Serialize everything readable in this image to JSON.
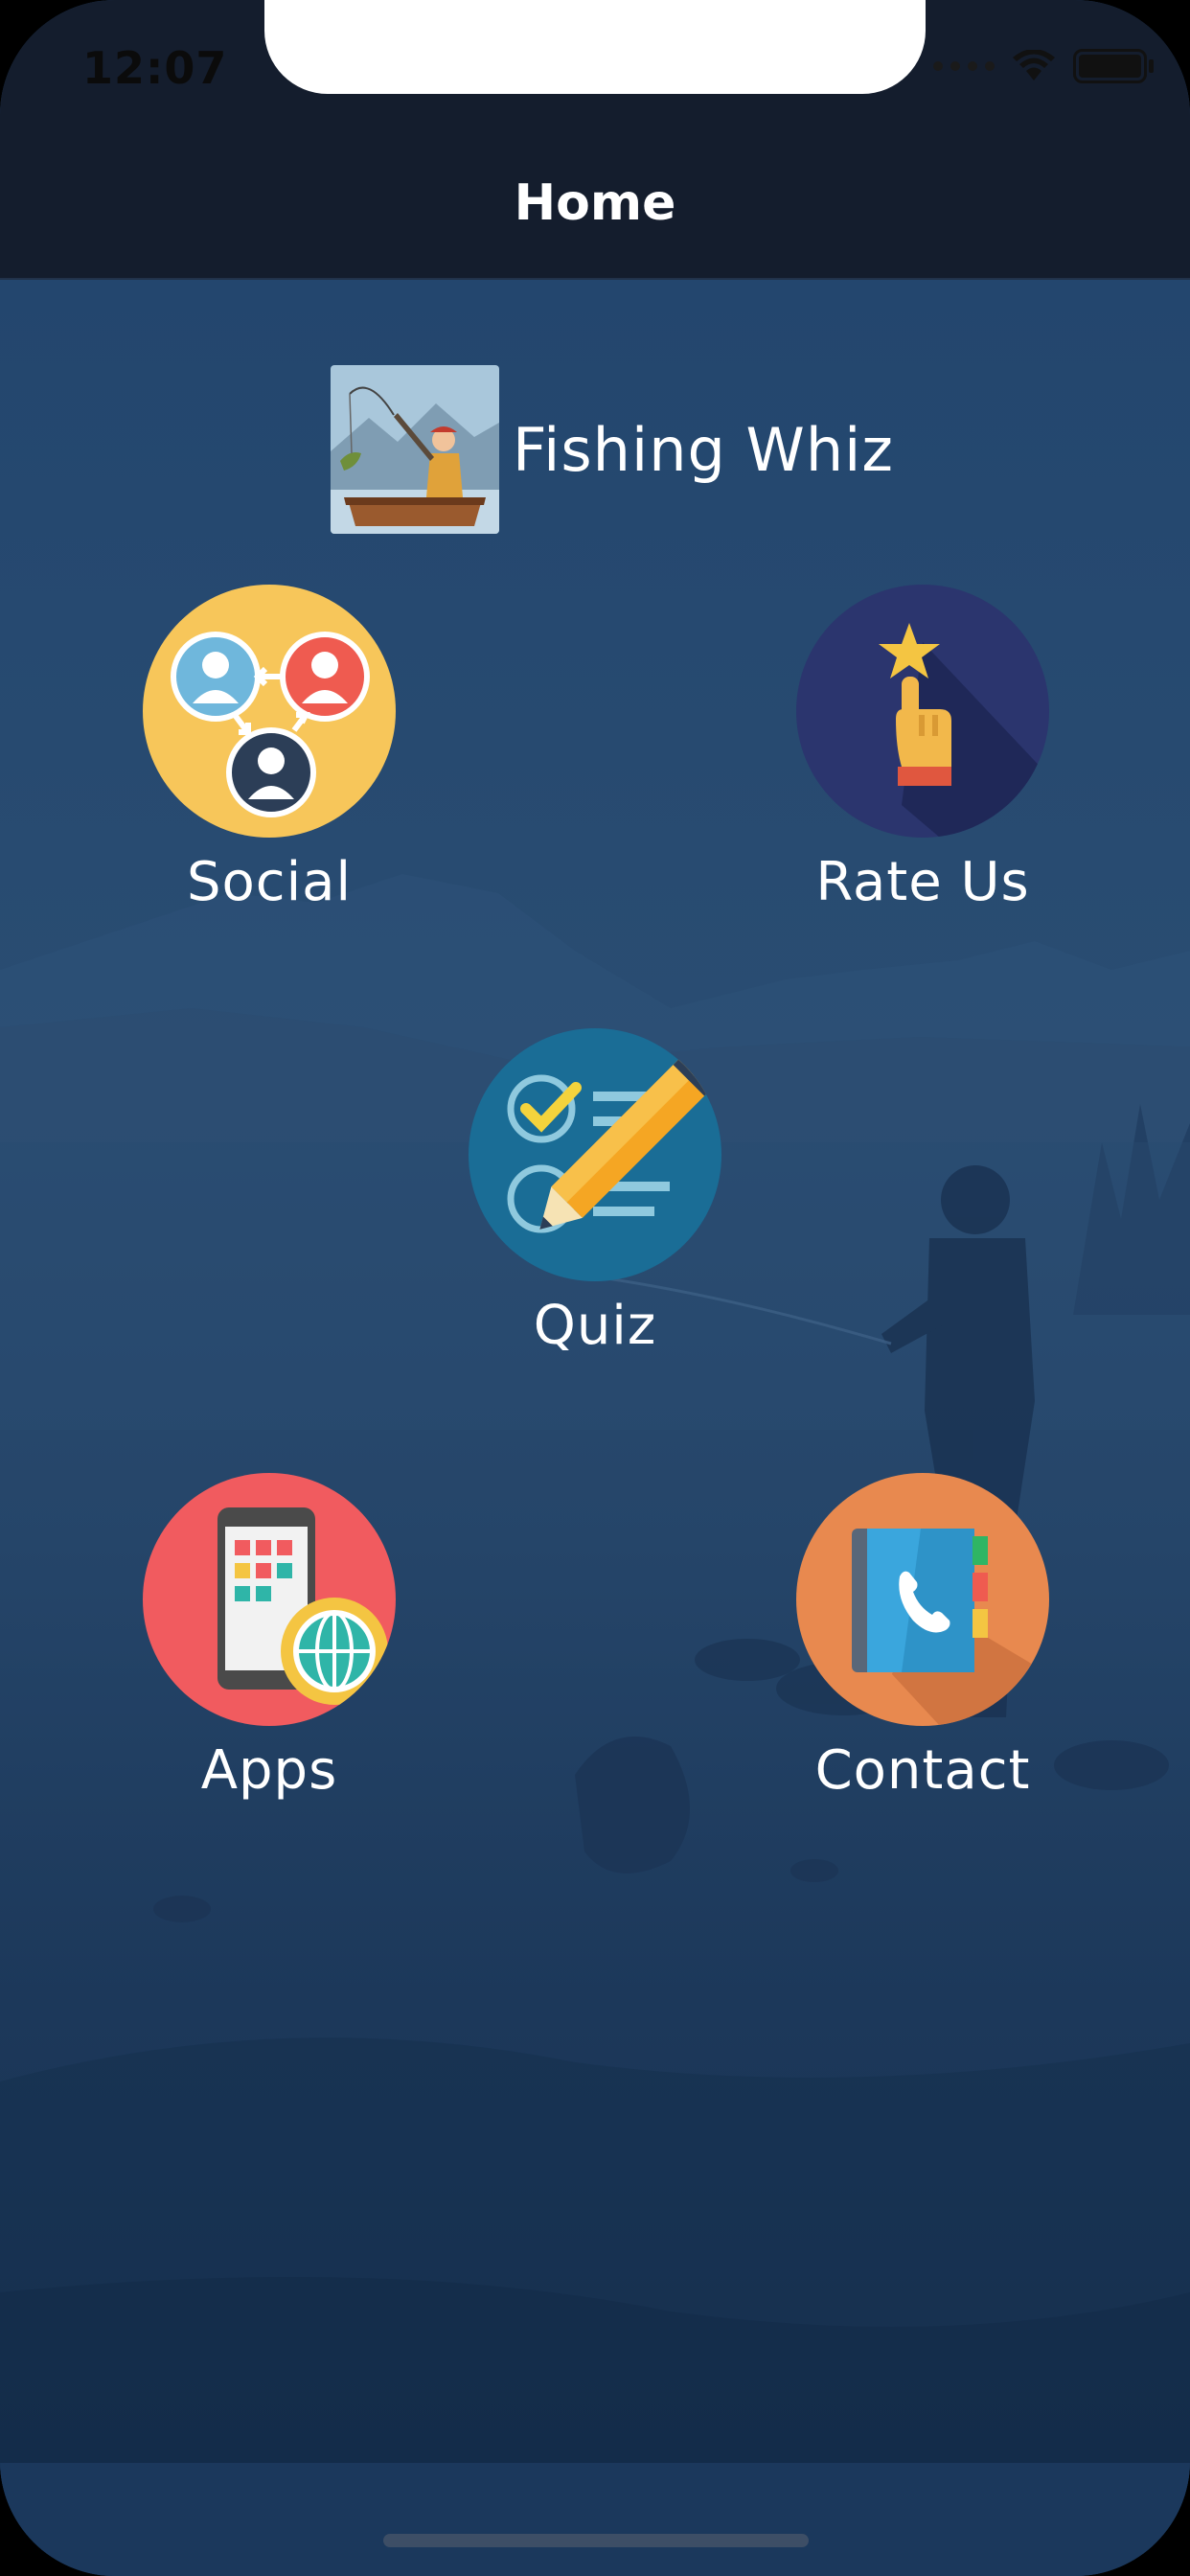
{
  "status_bar": {
    "time": "12:07"
  },
  "nav": {
    "title": "Home"
  },
  "app": {
    "name": "Fishing Whiz"
  },
  "tiles": [
    {
      "label": "Social",
      "icon": "social-network-icon",
      "color": "#f7c65a"
    },
    {
      "label": "Rate Us",
      "icon": "rate-star-icon",
      "color": "#2b356e"
    },
    {
      "label": "Quiz",
      "icon": "quiz-checklist-icon",
      "color": "#1a6d96"
    },
    {
      "label": "Apps",
      "icon": "apps-phone-icon",
      "color": "#f15b5f"
    },
    {
      "label": "Contact",
      "icon": "contact-book-icon",
      "color": "#e8894f"
    }
  ],
  "colors": {
    "nav_background": "#141d2d",
    "scene_background": "#23466e",
    "text": "#ffffff"
  }
}
